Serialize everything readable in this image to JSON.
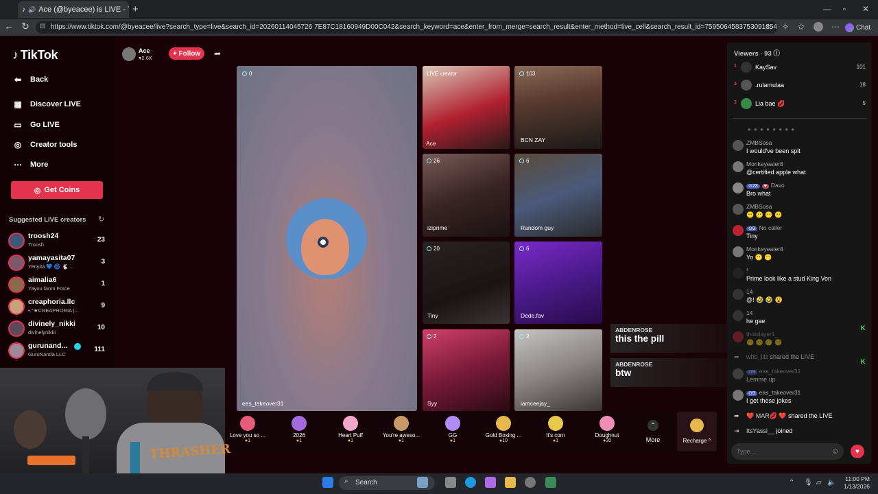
{
  "browser": {
    "tab_title": "Ace (@byeacee) is LIVE - TikT",
    "url": "https://www.tiktok.com/@byeacee/live?search_type=live&search_id=20260114045726 7E87C18160949D00C042&search_keyword=ace&enter_from_merge=search_result&enter_method=live_cell&search_result_id=7595064583753091854",
    "chat_label": "Chat"
  },
  "sidebar": {
    "logo": "TikTok",
    "nav": [
      {
        "label": "Back",
        "icon": "back-arrow-icon"
      },
      {
        "label": "Discover LIVE",
        "icon": "calendar-icon"
      },
      {
        "label": "Go LIVE",
        "icon": "camera-icon"
      },
      {
        "label": "Creator tools",
        "icon": "lightbulb-icon"
      },
      {
        "label": "More",
        "icon": "more-dots-icon"
      }
    ],
    "get_coins": "Get Coins",
    "suggested_title": "Suggested LIVE creators",
    "creators": [
      {
        "name": "troosh24",
        "sub": "Troosh",
        "count": "23"
      },
      {
        "name": "yamayasita07",
        "sub": "Yenyita 💙 🌀 🐇 ...",
        "count": "3"
      },
      {
        "name": "aimalia6",
        "sub": "Yayou fanm Force",
        "count": "1"
      },
      {
        "name": "creaphoria.llc",
        "sub": "•.°★CREAPHORIA |...",
        "count": "9"
      },
      {
        "name": "divinely_nikki",
        "sub": "divinelynikki",
        "count": "10"
      },
      {
        "name": "gurunand...",
        "sub": "GuruNanda LLC",
        "count": "111"
      }
    ]
  },
  "host": {
    "name": "Ace",
    "likes": "♥2.6K",
    "follow": "+ Follow"
  },
  "grid": {
    "main": {
      "count": "0",
      "label": "eas_takeover31"
    },
    "cells": [
      {
        "count": "LIVE creator",
        "label": "Ace"
      },
      {
        "count": "103",
        "label": "BCN ZAY"
      },
      {
        "count": "26",
        "label": "iziprime"
      },
      {
        "count": "6",
        "label": "Random guy"
      },
      {
        "count": "20",
        "label": "Tiny"
      },
      {
        "count": "6",
        "label": "Dede.fav"
      },
      {
        "count": "2",
        "label": "Syy"
      },
      {
        "count": "2",
        "label": "iamceejay_"
      }
    ]
  },
  "overlay_comments": [
    {
      "user": "ABDENROSE",
      "text": "this the pill"
    },
    {
      "user": "ABDENROSE",
      "text": "btw"
    }
  ],
  "gifts": [
    {
      "name": "Love you so ...",
      "price": "1",
      "color": "#e85b7a"
    },
    {
      "name": "2026",
      "price": "1",
      "color": "#a46be0"
    },
    {
      "name": "Heart Puff",
      "price": "1",
      "color": "#f2a7c9"
    },
    {
      "name": "You're aweso...",
      "price": "1",
      "color": "#c79a6a"
    },
    {
      "name": "GG",
      "price": "1",
      "color": "#b18cf5"
    },
    {
      "name": "Gold Boxing ...",
      "price": "10",
      "color": "#e6b84a"
    },
    {
      "name": "It's corn",
      "price": "1",
      "color": "#e8c94a"
    },
    {
      "name": "Doughnut",
      "price": "30",
      "color": "#ef8fb6"
    }
  ],
  "gift_more": "More",
  "recharge": "Recharge ^",
  "viewers": {
    "title": "Viewers · 93",
    "top": [
      {
        "rank": "1",
        "name": "KaySav",
        "score": "101"
      },
      {
        "rank": "2",
        "name": ".rulamulaa",
        "score": "18"
      },
      {
        "rank": "3",
        "name": "Lia bae 💋",
        "score": "5"
      }
    ]
  },
  "chat": [
    {
      "user": "ZMBSosa",
      "text": "I would've been spit"
    },
    {
      "user": "Monkeyeater8",
      "text": "@certified apple what"
    },
    {
      "user": "Davo",
      "level": "23",
      "text": "Bro what"
    },
    {
      "user": "ZMBSosa",
      "text": "😶 😶 😶 😶"
    },
    {
      "user": "No caller",
      "level": "9",
      "text": "Tiny"
    },
    {
      "user": "Monkeyeater8",
      "text": "Yo 😶 😶"
    },
    {
      "user": "!",
      "text": "Prime look like a stud King Von"
    },
    {
      "user": "14",
      "text": "@! 🤣 🤣 😮"
    },
    {
      "user": "14",
      "text": "he gae"
    },
    {
      "user": "thotslayer1_",
      "text": "😶 😶 😶 😶"
    }
  ],
  "chat_events": [
    {
      "user": "who_lllz",
      "text": "shared the LIVE"
    },
    {
      "user": "eas_takeover31",
      "level": "9",
      "text": "Lemme up"
    },
    {
      "user": "eas_takeover31",
      "level": "9",
      "text": "I get these jokes"
    },
    {
      "user": "❤️ MAR💋 ❤️",
      "text": "shared the LIVE"
    },
    {
      "user": "ItsYassi__",
      "text": "joined"
    }
  ],
  "input_placeholder": "Type...",
  "webcam_shirt": "THRASHER",
  "taskbar": {
    "search": "Search",
    "time": "11:00 PM",
    "date": "1/13/2026"
  }
}
